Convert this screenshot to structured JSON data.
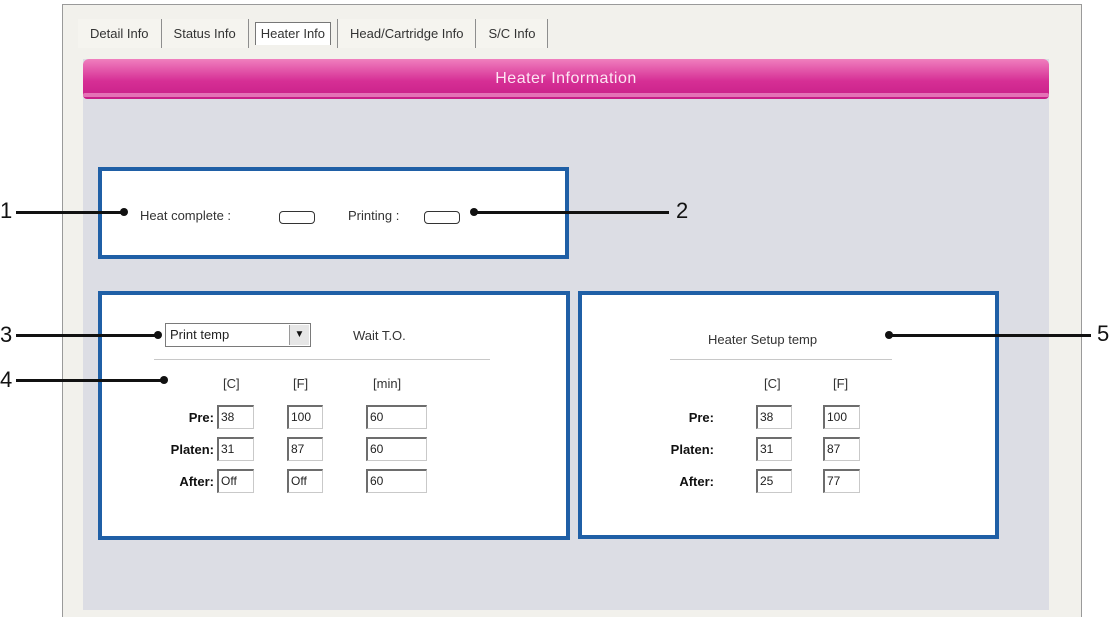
{
  "tabs": [
    {
      "label": "Detail Info"
    },
    {
      "label": "Status Info"
    },
    {
      "label": "Heater Info"
    },
    {
      "label": "Head/Cartridge Info"
    },
    {
      "label": "S/C Info"
    }
  ],
  "active_tab": "Heater Info",
  "header": {
    "title": "Heater Information"
  },
  "status": {
    "heat_complete_label": "Heat complete :",
    "printing_label": "Printing :"
  },
  "left_panel": {
    "select_value": "Print temp",
    "wait_label": "Wait T.O.",
    "columns": [
      "[C]",
      "[F]",
      "[min]"
    ],
    "rows": [
      {
        "label": "Pre:",
        "c": "38",
        "f": "100",
        "min": "60"
      },
      {
        "label": "Platen:",
        "c": "31",
        "f": "87",
        "min": "60"
      },
      {
        "label": "After:",
        "c": "Off",
        "f": "Off",
        "min": "60"
      }
    ]
  },
  "right_panel": {
    "title": "Heater Setup temp",
    "columns": [
      "[C]",
      "[F]"
    ],
    "rows": [
      {
        "label": "Pre:",
        "c": "38",
        "f": "100"
      },
      {
        "label": "Platen:",
        "c": "31",
        "f": "87"
      },
      {
        "label": "After:",
        "c": "25",
        "f": "77"
      }
    ]
  },
  "callouts": [
    "1",
    "2",
    "3",
    "4",
    "5"
  ],
  "colors": {
    "accent_pink": "#d62f95",
    "panel_border": "#1f5fa6",
    "content_bg": "#dcdde4"
  }
}
